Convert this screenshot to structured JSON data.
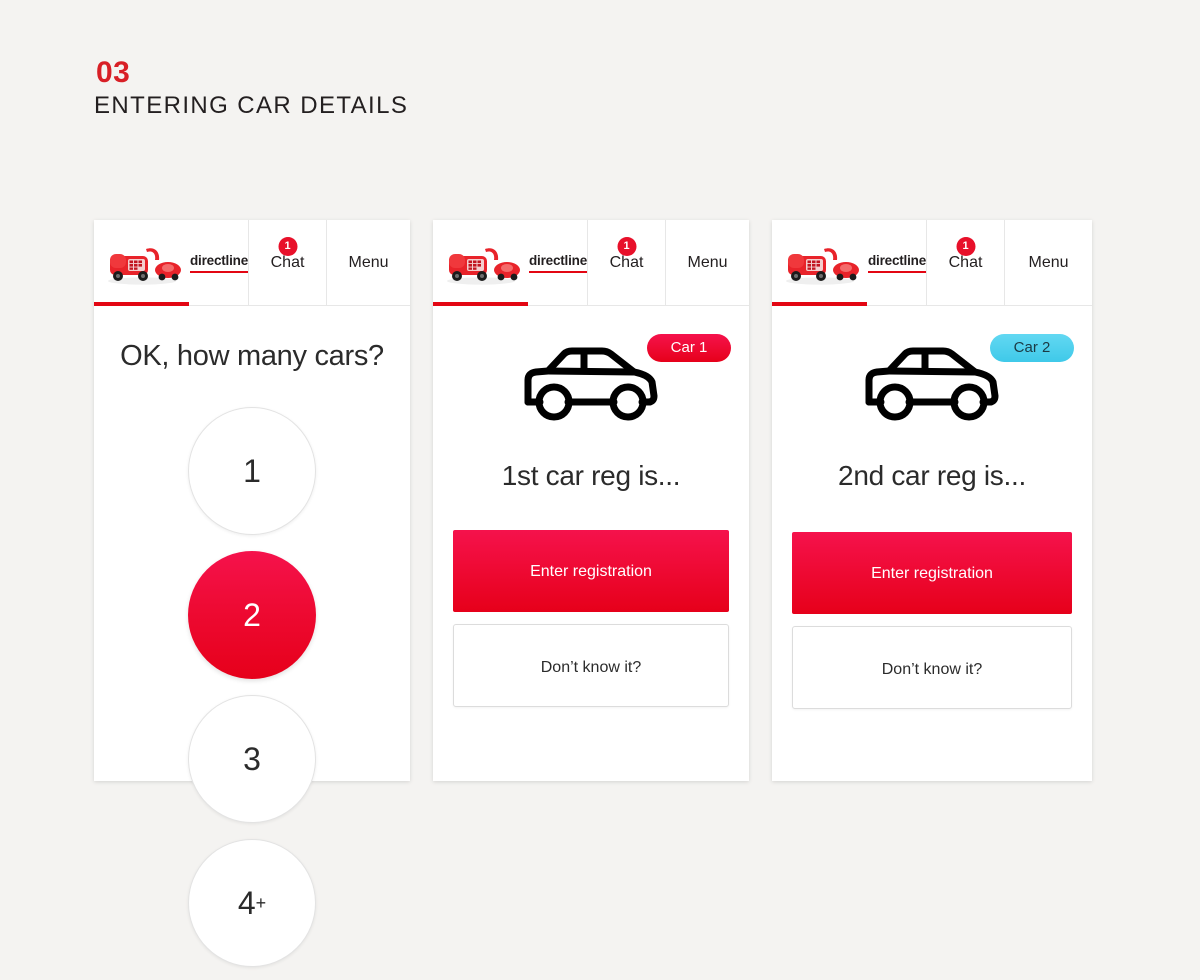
{
  "page": {
    "number": "03",
    "title": "ENTERING CAR DETAILS",
    "background_color": "#f4f3f1",
    "accent_color": "#e30613"
  },
  "header": {
    "brand_name": "directline",
    "logo_icon": "red-telephone-on-wheels-logo",
    "chat_label": "Chat",
    "chat_badge_count": "1",
    "menu_label": "Menu",
    "active_tab": "brand",
    "badge_color": "#e8102a"
  },
  "screens": [
    {
      "id": "car-count",
      "question": "OK, how many cars?",
      "options": [
        {
          "label": "1",
          "suffix": "",
          "selected": false
        },
        {
          "label": "2",
          "suffix": "",
          "selected": true
        },
        {
          "label": "3",
          "suffix": "",
          "selected": false
        },
        {
          "label": "4",
          "suffix": "+",
          "selected": false
        }
      ]
    },
    {
      "id": "first-car-reg",
      "badge": {
        "label": "Car 1",
        "color": "#ee0a33",
        "style": "red"
      },
      "car_icon": "car-side-outline-icon",
      "title": "1st car reg is...",
      "primary_button": "Enter registration",
      "secondary_button": "Don’t know it?"
    },
    {
      "id": "second-car-reg",
      "badge": {
        "label": "Car 2",
        "color": "#3fc9e9",
        "style": "blue"
      },
      "car_icon": "car-side-outline-icon",
      "title": "2nd car reg is...",
      "primary_button": "Enter registration",
      "secondary_button": "Don’t know it?"
    }
  ]
}
